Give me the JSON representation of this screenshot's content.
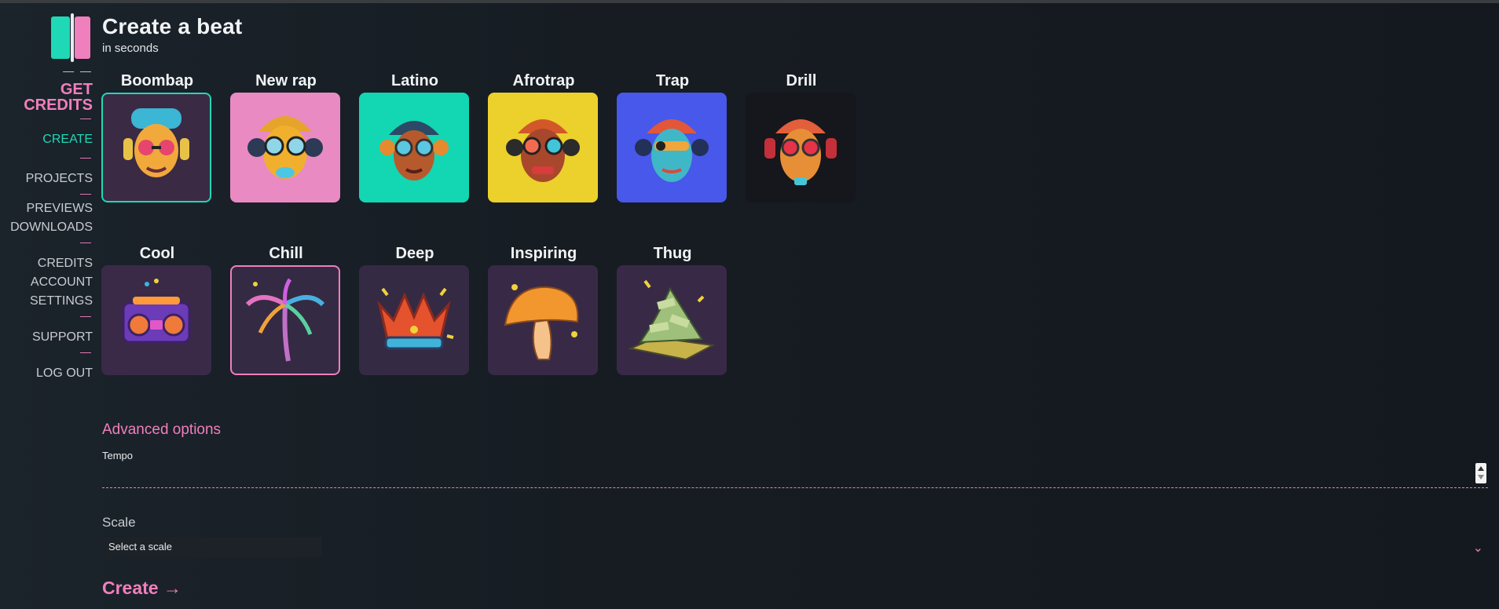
{
  "app": {
    "title": "Create a beat",
    "subtitle": "in seconds"
  },
  "sidebar": {
    "dash_top": "— —",
    "credits_line1": "GET",
    "credits_line2": "CREDITS",
    "items": [
      {
        "label": "CREATE",
        "active": true
      },
      {
        "label": "PROJECTS"
      },
      {
        "label": "PREVIEWS"
      },
      {
        "label": "DOWNLOADS"
      },
      {
        "label": "CREDITS"
      },
      {
        "label": "ACCOUNT"
      },
      {
        "label": "SETTINGS"
      },
      {
        "label": "SUPPORT"
      },
      {
        "label": "LOG OUT"
      }
    ],
    "dash": "—"
  },
  "genres_row1": [
    {
      "label": "Boombap",
      "bg": "#3b2a44",
      "selected": true,
      "icon": "boombap-face-icon"
    },
    {
      "label": "New rap",
      "bg": "#e98ac2",
      "icon": "new-rap-face-icon"
    },
    {
      "label": "Latino",
      "bg": "#13d6b3",
      "icon": "latino-face-icon"
    },
    {
      "label": "Afrotrap",
      "bg": "#ecd02c",
      "icon": "afrotrap-face-icon"
    },
    {
      "label": "Trap",
      "bg": "#4758ea",
      "icon": "trap-face-icon"
    },
    {
      "label": "Drill",
      "bg": "#16161d",
      "icon": "drill-face-icon"
    }
  ],
  "moods_row2": [
    {
      "label": "Cool",
      "bg": "#3a2a48",
      "icon": "boombox-icon"
    },
    {
      "label": "Chill",
      "bg": "#352a44",
      "selected": true,
      "icon": "palm-tree-icon"
    },
    {
      "label": "Deep",
      "bg": "#352a44",
      "icon": "crown-icon"
    },
    {
      "label": "Inspiring",
      "bg": "#382a46",
      "icon": "mushroom-icon"
    },
    {
      "label": "Thug",
      "bg": "#382a46",
      "icon": "money-pile-icon"
    }
  ],
  "advanced": {
    "title": "Advanced options",
    "tempo_label": "Tempo",
    "tempo_value": "",
    "scale_label": "Scale",
    "scale_selected": "Select a scale"
  },
  "cta": {
    "create_label": "Create →"
  },
  "colors": {
    "accent_pink": "#f07fbd",
    "accent_teal": "#1fd9b6"
  }
}
